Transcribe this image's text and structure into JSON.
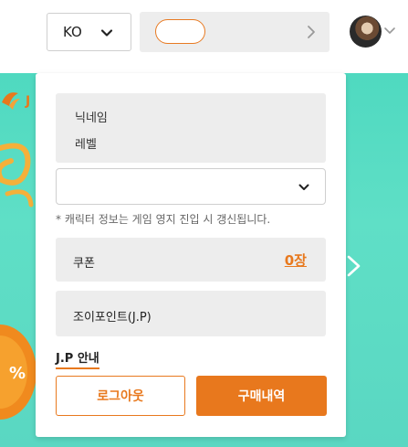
{
  "header": {
    "language": {
      "value": "KO",
      "icon": "chevron-down-icon"
    },
    "server_select": {
      "arrow_icon": "chevron-right-icon"
    },
    "profile_menu": {
      "avatar_icon": "avatar",
      "chevron_icon": "chevron-down-icon"
    }
  },
  "panel": {
    "profile": {
      "nickname_label": "닉네임",
      "level_label": "레벨"
    },
    "character_select": {
      "value": "",
      "icon": "chevron-down-icon"
    },
    "notice": "* 캐릭터 정보는 게임 영지 진입 시 갱신됩니다.",
    "coupon": {
      "label": "쿠폰",
      "count": "0장"
    },
    "joy_point": {
      "label": "조이포인트(J.P)"
    },
    "jp_guide_link": "J.P 안내",
    "buttons": {
      "logout": "로그아웃",
      "purchase_history": "구매내역"
    }
  },
  "banner": {
    "next_icon": "chevron-right-icon"
  },
  "colors": {
    "accent": "#e8791e",
    "banner_bg": "#5adcc4",
    "box_bg": "#ededed"
  }
}
